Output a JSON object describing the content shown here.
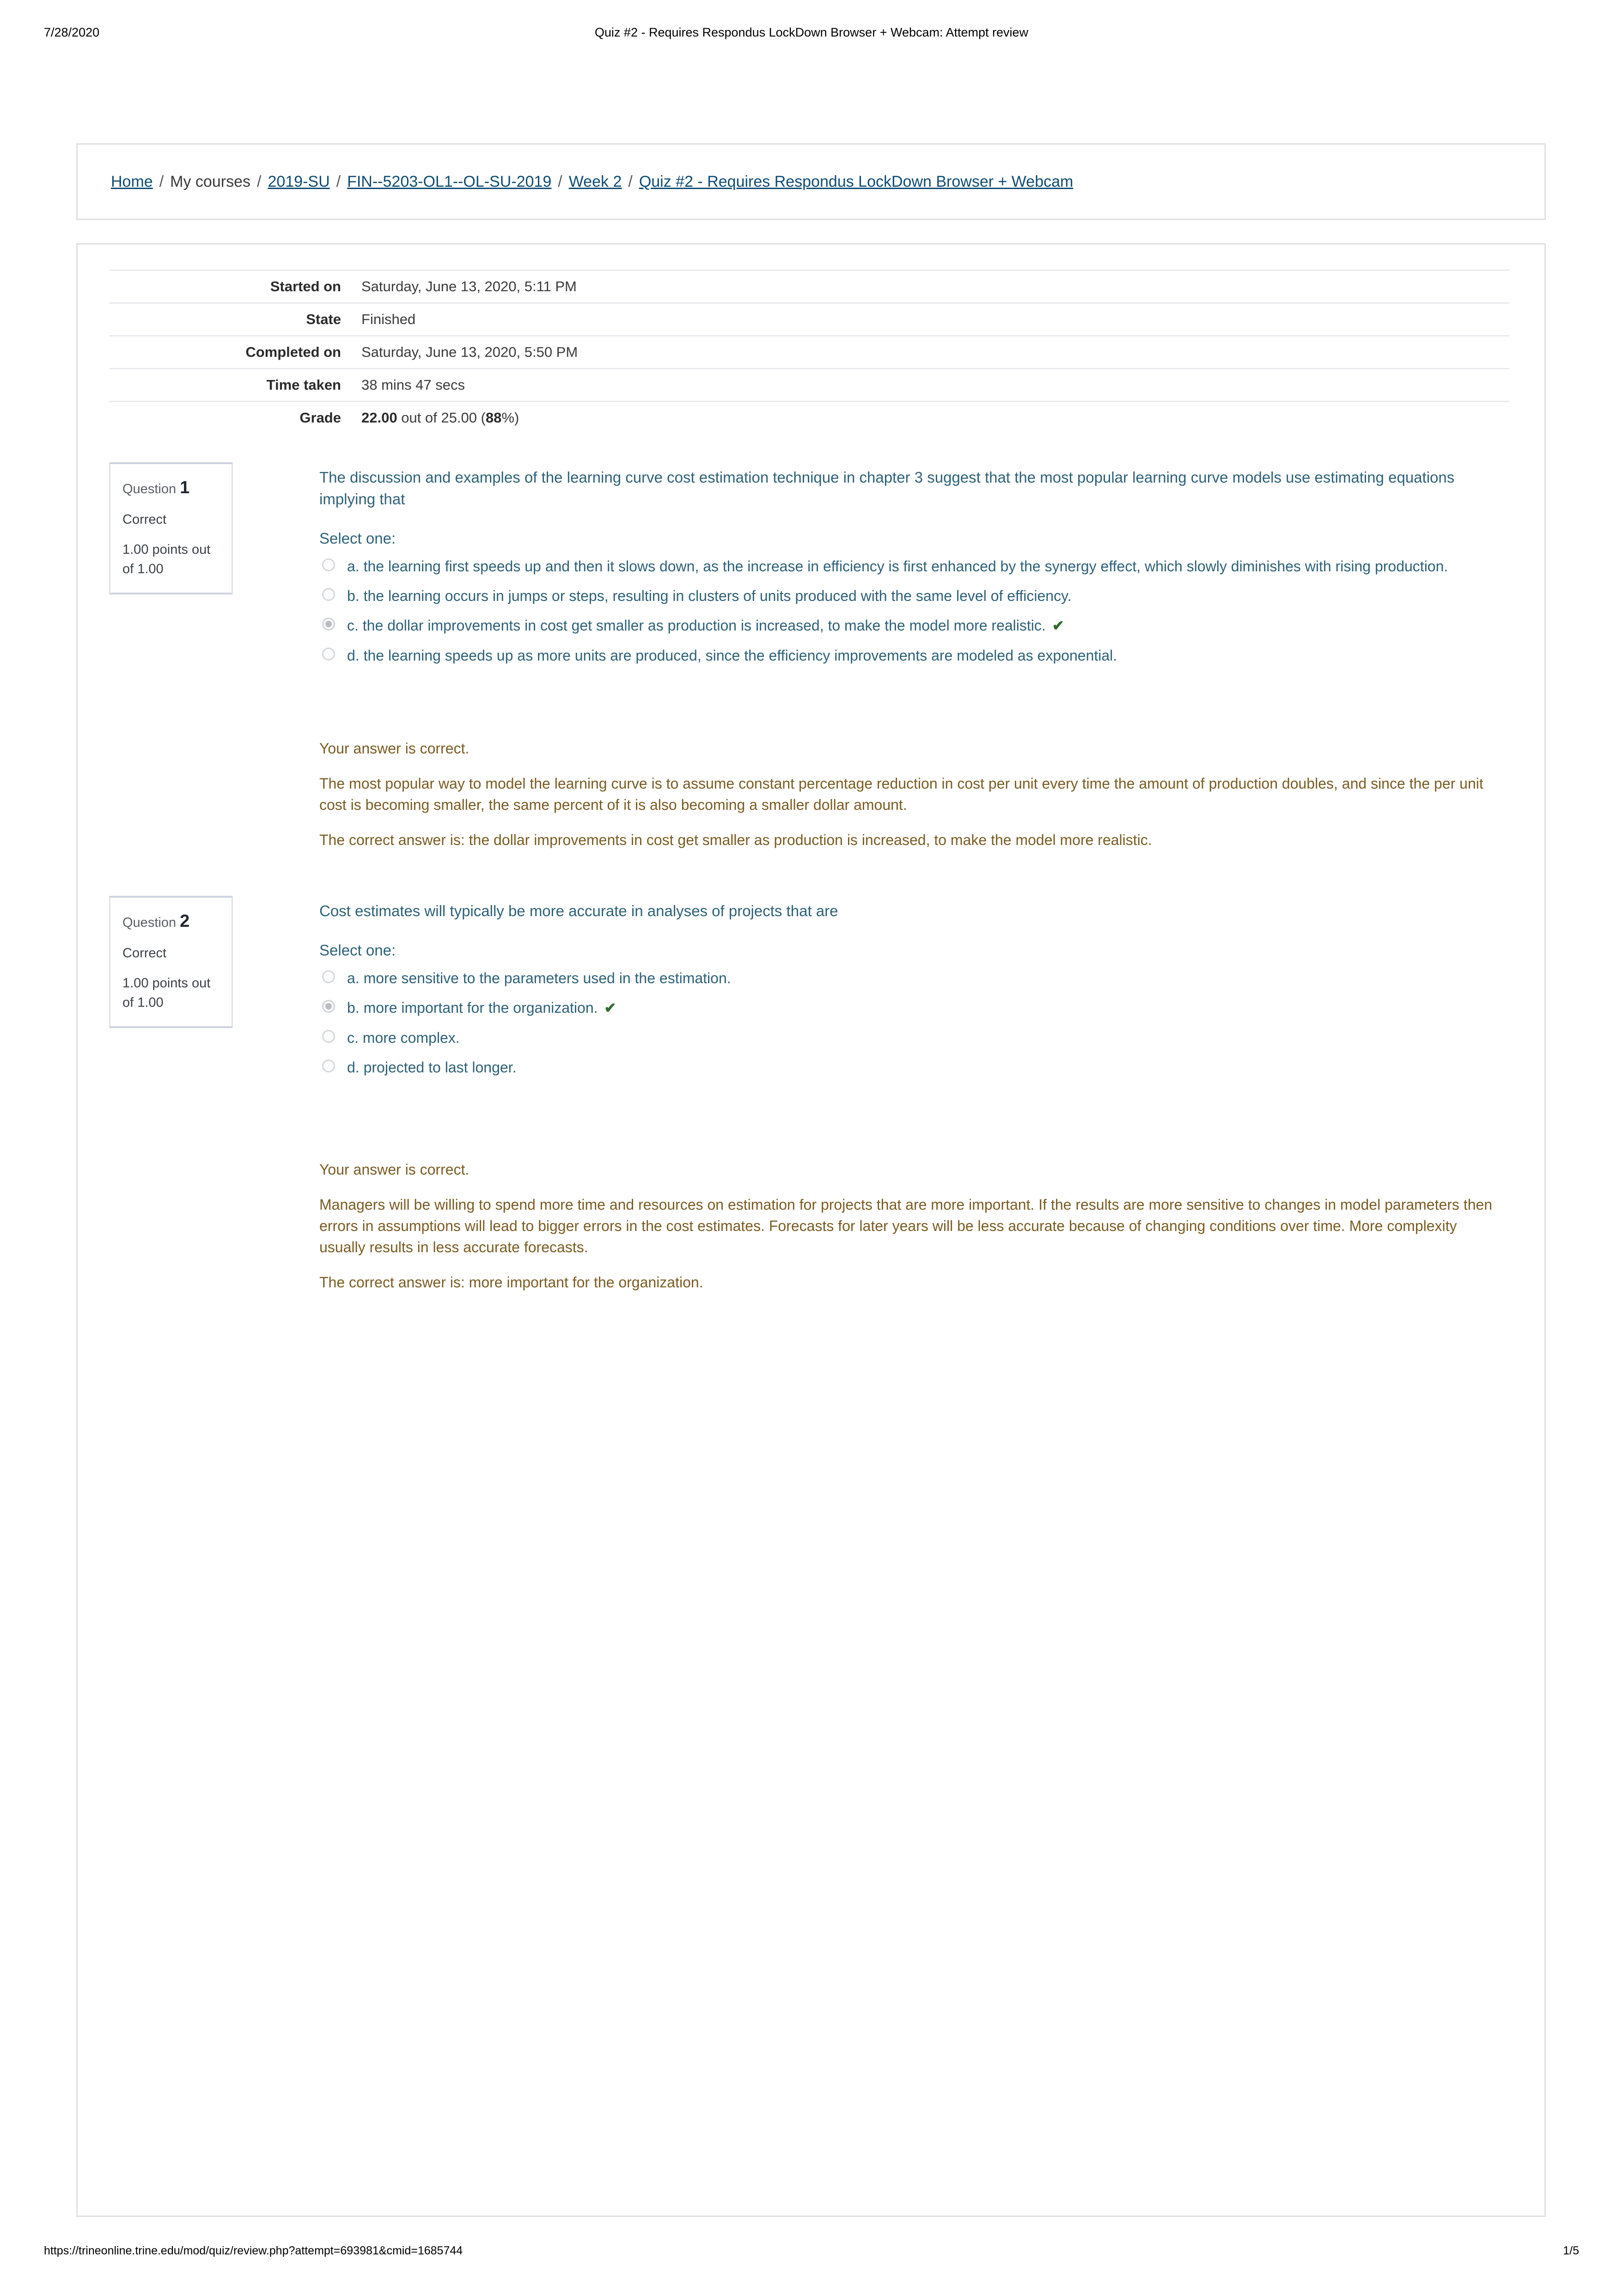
{
  "print_header": {
    "date": "7/28/2020",
    "title": "Quiz #2 - Requires Respondus LockDown Browser + Webcam: Attempt review"
  },
  "print_footer": {
    "url": "https://trineonline.trine.edu/mod/quiz/review.php?attempt=693981&cmid=1685744",
    "page": "1/5"
  },
  "breadcrumb": {
    "items": [
      {
        "label": "Home",
        "link": true
      },
      {
        "label": "My courses",
        "link": false
      },
      {
        "label": "2019-SU",
        "link": true
      },
      {
        "label": "FIN--5203-OL1--OL-SU-2019",
        "link": true
      },
      {
        "label": "Week 2",
        "link": true
      },
      {
        "label": "Quiz #2 - Requires Respondus LockDown Browser + Webcam",
        "link": true
      }
    ],
    "separator": "/"
  },
  "attempt_summary": {
    "rows": [
      {
        "label": "Started on",
        "value": "Saturday, June 13, 2020, 5:11 PM"
      },
      {
        "label": "State",
        "value": "Finished"
      },
      {
        "label": "Completed on",
        "value": "Saturday, June 13, 2020, 5:50 PM"
      },
      {
        "label": "Time taken",
        "value": "38 mins 47 secs"
      }
    ],
    "grade": {
      "label": "Grade",
      "score": "22.00",
      "middle": " out of 25.00 (",
      "percent": "88",
      "suffix": "%)"
    }
  },
  "questions": [
    {
      "number_label": "Question",
      "number": "1",
      "state": "Correct",
      "grade_line1": "1.00 points out",
      "grade_line2": "of 1.00",
      "stem": "The discussion and examples of the learning curve cost estimation technique in chapter 3 suggest that the most popular learning curve models use estimating equations implying that",
      "select_label": "Select one:",
      "options": [
        {
          "text": "a. the learning first speeds up and then it slows down, as the increase in efficiency is first enhanced by the synergy effect, which slowly diminishes with rising production.",
          "selected": false,
          "correct_mark": false
        },
        {
          "text": "b. the learning occurs in jumps or steps, resulting in clusters of units produced with the same level of efficiency.",
          "selected": false,
          "correct_mark": false
        },
        {
          "text": "c. the dollar improvements in cost get smaller as production is increased, to make the model more realistic.",
          "selected": true,
          "correct_mark": true
        },
        {
          "text": "d. the learning speeds up as more units are produced, since the efficiency improvements are modeled as exponential.",
          "selected": false,
          "correct_mark": false
        }
      ],
      "feedback": [
        "Your answer is correct.",
        "The most popular way to model the learning curve is to assume constant percentage reduction in cost per unit every time the amount of production doubles, and since the per unit cost is becoming smaller, the same percent of it is also becoming a smaller dollar amount.",
        "The correct answer is: the dollar improvements in cost get smaller as production is increased, to make the model more realistic."
      ]
    },
    {
      "number_label": "Question",
      "number": "2",
      "state": "Correct",
      "grade_line1": "1.00 points out",
      "grade_line2": "of 1.00",
      "stem": "Cost estimates will typically be more accurate in analyses of projects that are",
      "select_label": "Select one:",
      "options": [
        {
          "text": "a. more sensitive to the parameters used in the estimation.",
          "selected": false,
          "correct_mark": false
        },
        {
          "text": "b. more important for the organization.",
          "selected": true,
          "correct_mark": true
        },
        {
          "text": "c. more complex.",
          "selected": false,
          "correct_mark": false
        },
        {
          "text": "d. projected to last longer.",
          "selected": false,
          "correct_mark": false
        }
      ],
      "feedback": [
        "Your answer is correct.",
        "Managers will be willing to spend more time and resources on estimation for projects that are more important. If the results are more sensitive to changes in model parameters then errors in assumptions will lead to bigger errors in the cost estimates. Forecasts for later years will be less accurate because of changing conditions over time. More complexity usually results in less accurate forecasts.",
        "The correct answer is: more important for the organization."
      ]
    }
  ],
  "icons": {
    "correct_tick": "✔"
  },
  "colors": {
    "link": "#0f4c75",
    "question_text": "#2e6178",
    "feedback_text": "#7a5c23",
    "correct_green": "#2f6b2f",
    "card_border": "#e0e0e0"
  }
}
